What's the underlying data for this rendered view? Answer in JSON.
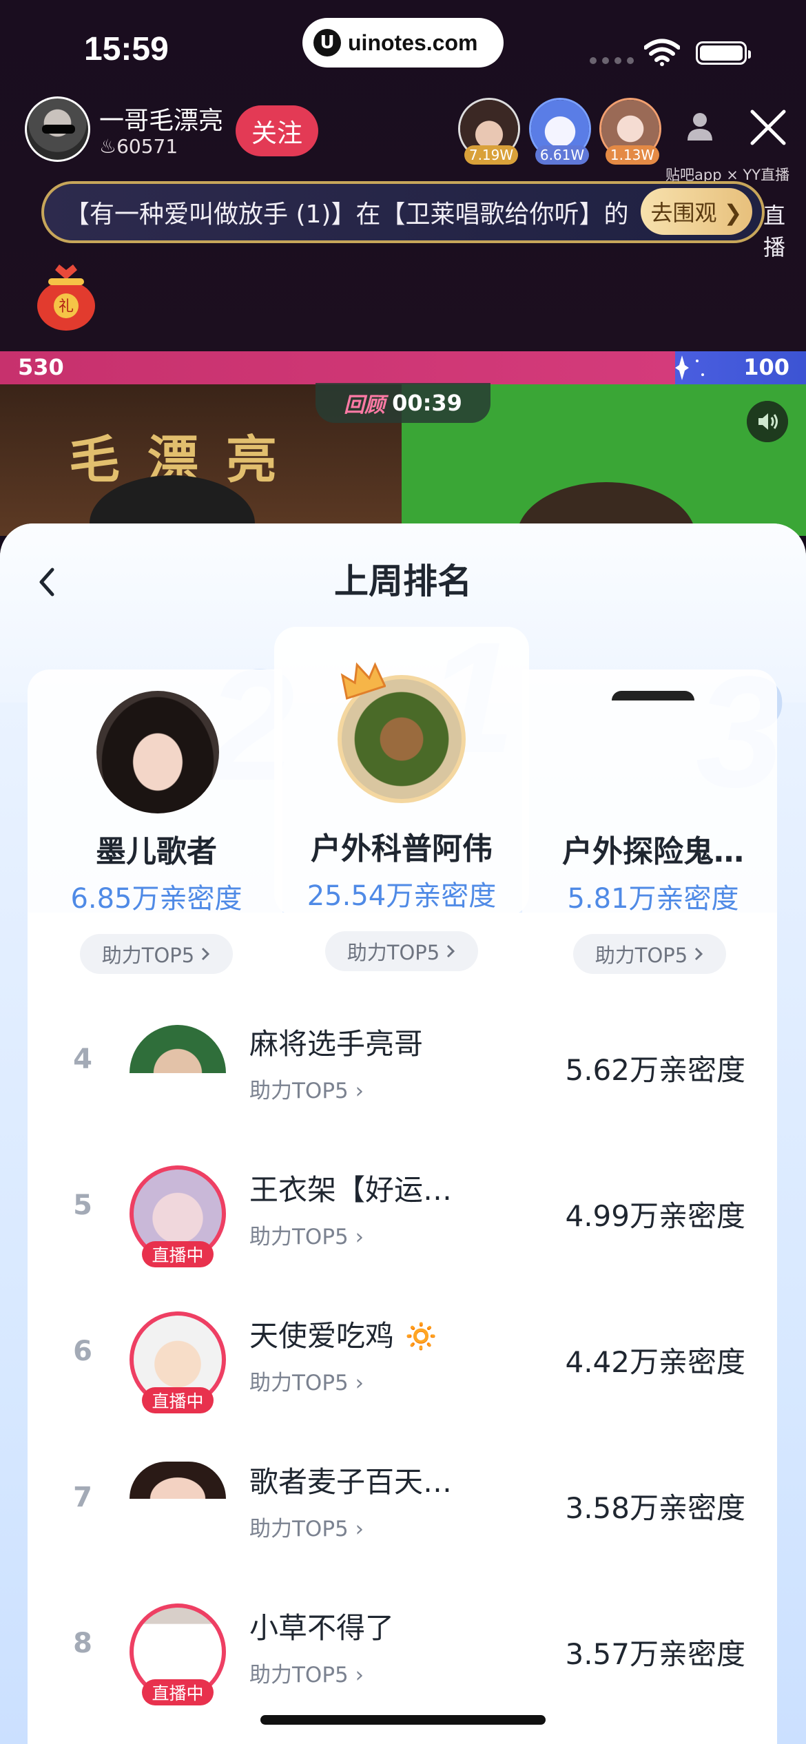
{
  "status_bar": {
    "time": "15:59",
    "url_logo": "U",
    "url": "uinotes.com"
  },
  "host": {
    "name": "一哥毛漂亮",
    "fire_count": "♨60571",
    "follow_label": "关注"
  },
  "viewers": [
    {
      "badge": "7.19W"
    },
    {
      "badge": "6.61W"
    },
    {
      "badge": "1.13W"
    }
  ],
  "promo_text": "贴吧app × YY直播",
  "marquee": {
    "text": "【有一种爱叫做放手 (1)】在【卫莱唱歌给你听】的",
    "button": "去围观 ❯",
    "side_label": "直播"
  },
  "gift_bag_label": "礼",
  "pk": {
    "left_score": "530",
    "right_score": "100"
  },
  "video": {
    "title_text": "毛漂亮",
    "replay_label": "回顾",
    "replay_time": "00:39"
  },
  "panel": {
    "title": "上周排名",
    "podium_numbers": {
      "first": "1",
      "second": "2",
      "third": "3"
    },
    "podium": [
      {
        "name": "墨儿歌者",
        "value": "6.85万亲密度",
        "top_label": "助力TOP5"
      },
      {
        "name": "户外科普阿伟",
        "value": "25.54万亲密度",
        "top_label": "助力TOP5"
      },
      {
        "name": "户外探险鬼…",
        "value": "5.81万亲密度",
        "top_label": "助力TOP5"
      }
    ],
    "list": [
      {
        "rank": "4",
        "name": "麻将选手亮哥",
        "top_label": "助力TOP5",
        "value": "5.62万亲密度",
        "live": ""
      },
      {
        "rank": "5",
        "name": "王衣架【好运…",
        "top_label": "助力TOP5",
        "value": "4.99万亲密度",
        "live": "直播中"
      },
      {
        "rank": "6",
        "name": "天使爱吃鸡 🔅",
        "top_label": "助力TOP5",
        "value": "4.42万亲密度",
        "live": "直播中"
      },
      {
        "rank": "7",
        "name": "歌者麦子百天…",
        "top_label": "助力TOP5",
        "value": "3.58万亲密度",
        "live": ""
      },
      {
        "rank": "8",
        "name": "小草不得了",
        "top_label": "助力TOP5",
        "value": "3.57万亲密度",
        "live": "直播中"
      }
    ]
  },
  "colors": {
    "follow": "#e33a55",
    "pk_left": "#c7316d",
    "pk_right": "#4a5ee0",
    "accent_blue": "#4f8ae6",
    "live_red": "#e8314d"
  }
}
